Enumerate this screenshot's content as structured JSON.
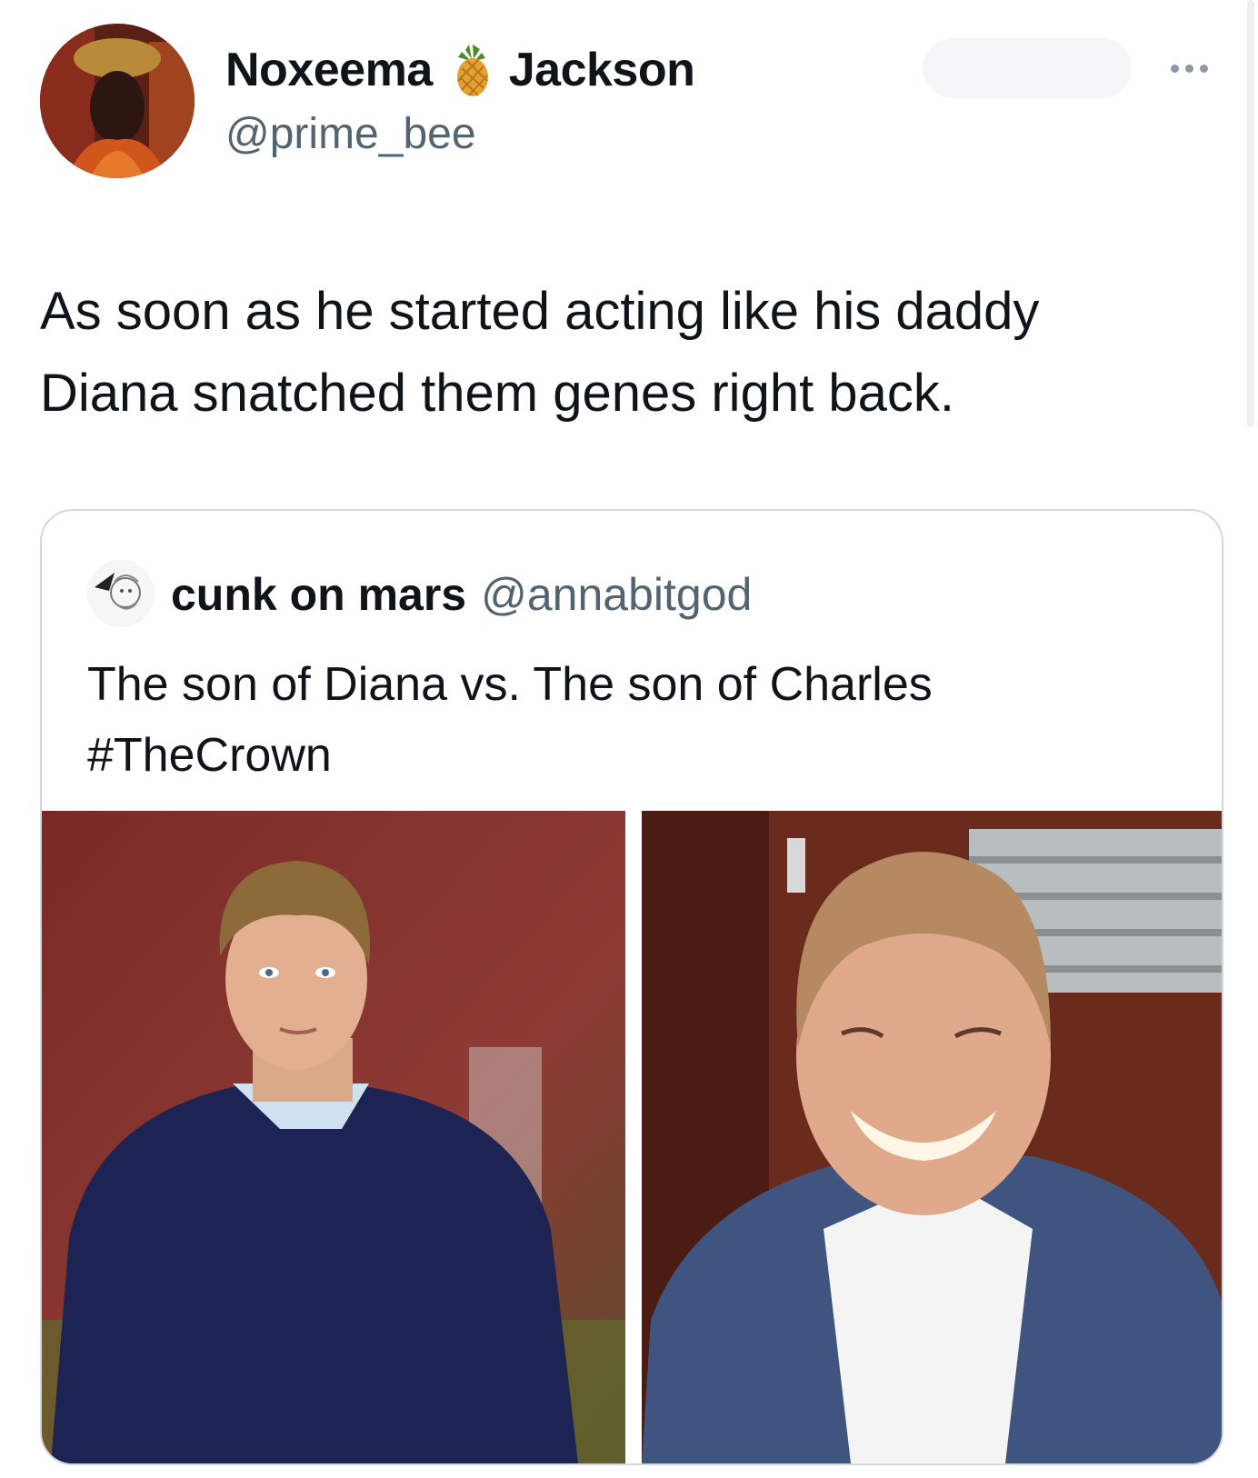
{
  "author": {
    "first_name": "Noxeema",
    "last_name": "Jackson",
    "name_emoji": "pineapple-icon",
    "handle": "@prime_bee"
  },
  "tweet": {
    "text": "As soon as he started acting like his daddy\nDiana snatched them genes right back."
  },
  "quoted": {
    "name": "cunk on mars",
    "handle": "@annabitgod",
    "text": "The son of Diana vs. The son of Charles\n#TheCrown"
  },
  "colors": {
    "text": "#0f1419",
    "secondary": "#536471",
    "border": "#cfd9de"
  }
}
